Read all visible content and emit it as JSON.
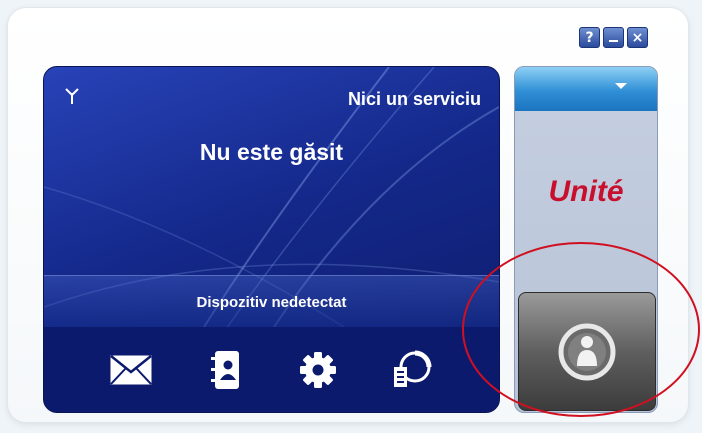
{
  "window": {
    "buttons": {
      "help": "?",
      "minimize": "_",
      "close": "×"
    }
  },
  "status": {
    "service": "Nici un serviciu",
    "network": "Nu este găsit",
    "device": "Dispozitiv nedetectat"
  },
  "brand": {
    "name": "Unité",
    "color": "#c8102e"
  },
  "toolbar": {
    "icons": [
      "envelope-icon",
      "contacts-icon",
      "settings-gear-icon",
      "connection-log-icon"
    ]
  },
  "side": {
    "dropdown_icon": "chevron-down-icon",
    "connect_icon": "person-icon"
  },
  "annotation": {
    "color": "#d01020"
  }
}
